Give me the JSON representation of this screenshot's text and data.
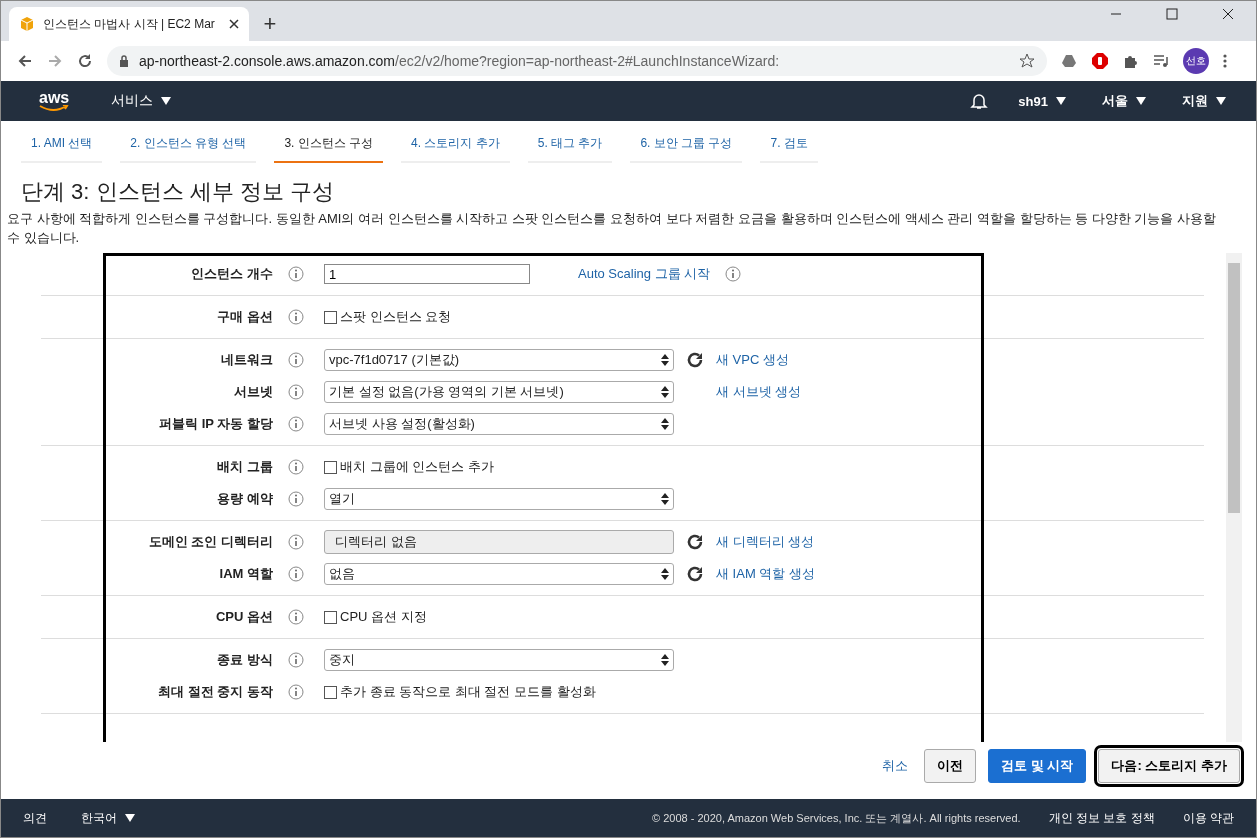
{
  "browser": {
    "tab_title": "인스턴스 마법사 시작 | EC2 Mar",
    "new_tab": "+",
    "url_host": "ap-northeast-2.console.aws.amazon.com",
    "url_path": "/ec2/v2/home?region=ap-northeast-2#LaunchInstanceWizard:",
    "profile": "선호"
  },
  "aws_nav": {
    "logo": "aws",
    "services": "서비스",
    "user": "sh91",
    "region": "서울",
    "support": "지원"
  },
  "steps": [
    {
      "label": "1. AMI 선택",
      "selected": false
    },
    {
      "label": "2. 인스턴스 유형 선택",
      "selected": false
    },
    {
      "label": "3. 인스턴스 구성",
      "selected": true
    },
    {
      "label": "4. 스토리지 추가",
      "selected": false
    },
    {
      "label": "5. 태그 추가",
      "selected": false
    },
    {
      "label": "6. 보안 그룹 구성",
      "selected": false
    },
    {
      "label": "7. 검토",
      "selected": false
    }
  ],
  "title": "단계 3: 인스턴스 세부 정보 구성",
  "description": "요구 사항에 적합하게 인스턴스를 구성합니다. 동일한 AMI의 여러 인스턴스를 시작하고 스팟 인스턴스를 요청하여 보다 저렴한 요금을 활용하며 인스턴스에 액세스 관리 역할을 할당하는 등 다양한 기능을 사용할 수 있습니다.",
  "form": {
    "sections": [
      {
        "rows": [
          {
            "label": "인스턴스 개수",
            "kind": "input",
            "value": "1",
            "link": "Auto Scaling 그룹 시작",
            "link_info": true
          }
        ]
      },
      {
        "rows": [
          {
            "label": "구매 옵션",
            "kind": "checkbox",
            "checked": false,
            "value": "스팟 인스턴스 요청"
          }
        ]
      },
      {
        "rows": [
          {
            "label": "네트워크",
            "kind": "select",
            "value": "vpc-7f1d0717 (기본값)",
            "refresh": true,
            "link": "새 VPC 생성"
          },
          {
            "label": "서브넷",
            "kind": "select",
            "value": "기본 설정 없음(가용 영역의 기본 서브넷)",
            "link": "새 서브넷 생성"
          },
          {
            "label": "퍼블릭 IP 자동 할당",
            "kind": "select",
            "value": "서브넷 사용 설정(활성화)"
          }
        ]
      },
      {
        "rows": [
          {
            "label": "배치 그룹",
            "kind": "checkbox",
            "checked": false,
            "value": "배치 그룹에 인스턴스 추가"
          },
          {
            "label": "용량 예약",
            "kind": "select",
            "value": "열기"
          }
        ]
      },
      {
        "rows": [
          {
            "label": "도메인 조인 디렉터리",
            "kind": "readonly",
            "value": "디렉터리 없음",
            "refresh": true,
            "link": "새 디렉터리 생성"
          },
          {
            "label": "IAM 역할",
            "kind": "select",
            "value": "없음",
            "refresh": true,
            "link": "새 IAM 역할 생성"
          }
        ]
      },
      {
        "rows": [
          {
            "label": "CPU 옵션",
            "kind": "checkbox",
            "checked": false,
            "value": "CPU 옵션 지정"
          }
        ]
      },
      {
        "rows": [
          {
            "label": "종료 방식",
            "kind": "select",
            "value": "중지"
          },
          {
            "label": "최대 절전 중지 동작",
            "kind": "checkbox",
            "checked": false,
            "value": "추가 종료 동작으로 최대 절전 모드를 활성화"
          }
        ]
      }
    ]
  },
  "actions": {
    "cancel": "취소",
    "previous": "이전",
    "review": "검토 및 시작",
    "next": "다음: 스토리지 추가"
  },
  "footer": {
    "feedback": "의견",
    "language": "한국어",
    "copyright": "© 2008 - 2020, Amazon Web Services, Inc. 또는 계열사. All rights reserved.",
    "privacy": "개인 정보 보호 정책",
    "terms": "이용 약관"
  }
}
